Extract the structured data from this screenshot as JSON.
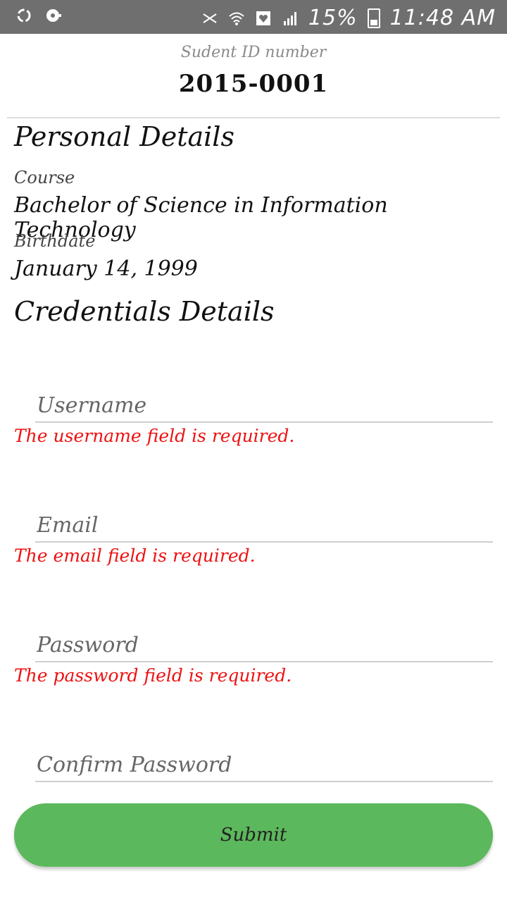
{
  "status_bar": {
    "battery": "15%",
    "time": "11:48 AM",
    "icons": [
      "sync-icon",
      "media-icon",
      "mute-icon",
      "wifi-icon",
      "heart-icon",
      "signal-icon",
      "battery-icon"
    ]
  },
  "header": {
    "student_id_label": "Sudent ID number",
    "student_id_value": "2015-0001"
  },
  "personal": {
    "title": "Personal Details",
    "course_label": "Course",
    "course_value": "Bachelor of Science in Information Technology",
    "birthdate_label": "Birthdate",
    "birthdate_value": "January 14, 1999"
  },
  "credentials": {
    "title": "Credentials Details",
    "username": {
      "placeholder": "Username",
      "error": "The username field is required."
    },
    "email": {
      "placeholder": "Email",
      "error": "The email field is required."
    },
    "password": {
      "placeholder": "Password",
      "error": "The password field is required."
    },
    "confirm_password": {
      "placeholder": "Confirm Password"
    }
  },
  "submit_label": "Submit",
  "colors": {
    "status_bar": "#6f6f6f",
    "error": "#ee1111",
    "submit": "#5cb85c"
  }
}
